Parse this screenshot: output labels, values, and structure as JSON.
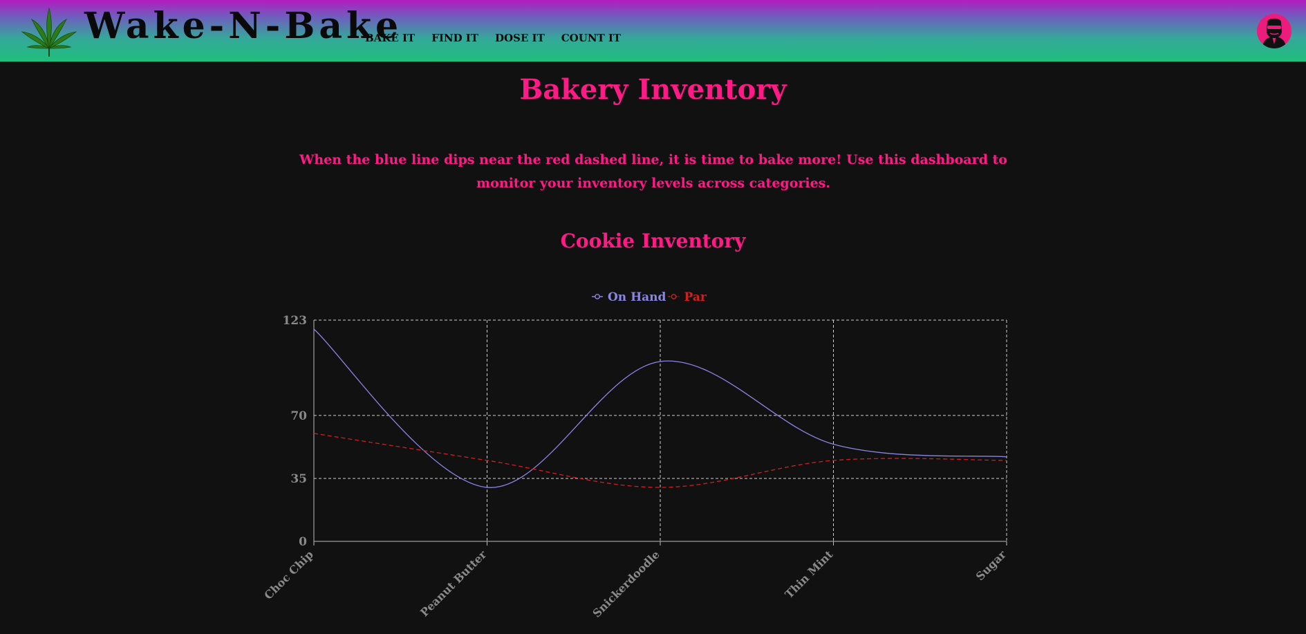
{
  "header": {
    "brand": "Wake-N-Bake",
    "nav": [
      "BAKE IT",
      "FIND IT",
      "DOSE IT",
      "COUNT IT"
    ],
    "logo_icon": "cannabis-leaf-icon",
    "avatar_icon": "user-avatar-icon",
    "gradient": [
      "#b21cc0",
      "#6e5fbe",
      "#35a89a",
      "#1fbe7c"
    ]
  },
  "page": {
    "title": "Bakery Inventory",
    "intro": "When the blue line dips near the red dashed line, it is time to bake more! Use this dashboard to monitor your inventory levels across categories.",
    "accent_color": "#ff1a86",
    "background": "#111111"
  },
  "chart_data": {
    "type": "line",
    "title": "Cookie Inventory",
    "categories": [
      "Choc Chip",
      "Peanut Butter",
      "Snickerdoodle",
      "Thin Mint",
      "Sugar"
    ],
    "series": [
      {
        "name": "On Hand",
        "values": [
          118,
          30,
          100,
          54,
          47
        ],
        "color": "#8b85e6",
        "dashed": false
      },
      {
        "name": "Par",
        "values": [
          60,
          45,
          30,
          45,
          45
        ],
        "color": "#d21f1f",
        "dashed": true
      }
    ],
    "y_ticks": [
      0,
      35,
      70,
      123
    ],
    "ylim": [
      0,
      123
    ],
    "grid": true,
    "legend": "top-center",
    "xlabel": "",
    "ylabel": ""
  }
}
